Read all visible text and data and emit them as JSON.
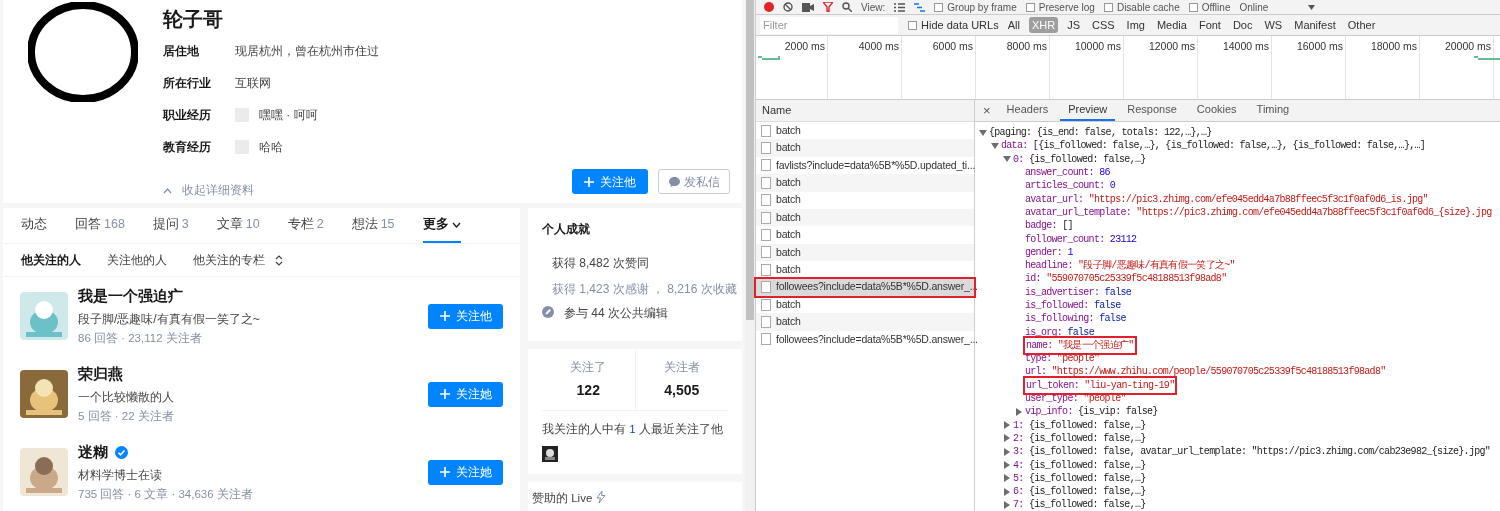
{
  "profile": {
    "name": "轮子哥",
    "info": [
      {
        "label": "居住地",
        "value": "现居杭州，曾在杭州市住过",
        "has_logo": false
      },
      {
        "label": "所在行业",
        "value": "互联网",
        "has_logo": false
      },
      {
        "label": "职业经历",
        "value": "嘿嘿 · 呵呵",
        "has_logo": true
      },
      {
        "label": "教育经历",
        "value": "哈哈",
        "has_logo": true
      }
    ],
    "collapse_link": "收起详细资料",
    "follow_button": "关注他",
    "message_button": "发私信"
  },
  "tabs": [
    {
      "label": "动态",
      "selected": false
    },
    {
      "label": "回答",
      "count": "168",
      "selected": false
    },
    {
      "label": "提问",
      "count": "3",
      "selected": false
    },
    {
      "label": "文章",
      "count": "10",
      "selected": false
    },
    {
      "label": "专栏",
      "count": "2",
      "selected": false
    },
    {
      "label": "想法",
      "count": "15",
      "selected": false
    },
    {
      "label": "更多",
      "has_menu": true,
      "selected": true
    }
  ],
  "subtabs": [
    {
      "label": "他关注的人",
      "selected": true
    },
    {
      "label": "关注他的人",
      "selected": false
    },
    {
      "label": "他关注的专栏",
      "has_menu": true,
      "selected": false
    }
  ],
  "people": [
    {
      "name": "我是一个强迫疒",
      "verified": false,
      "headline": "段子脚/恶趣味/有真有假一笑了之~",
      "stats": "86 回答 · 23,112 关注者",
      "button": "关注他"
    },
    {
      "name": "荣归燕",
      "verified": false,
      "headline": "一个比较懒散的人",
      "stats": "5 回答 · 22 关注者",
      "button": "关注她"
    },
    {
      "name": "迷糊",
      "verified": true,
      "headline": "材料学博士在读",
      "stats": "735 回答 · 6 文章 · 34,636 关注者",
      "button": "关注她"
    }
  ],
  "achievements": {
    "title": "个人成就",
    "items": [
      {
        "kind": "like",
        "lines": [
          "获得 8,482 次赞同",
          "获得 1,423 次感谢 ， 8,216 次收藏"
        ]
      },
      {
        "kind": "edit",
        "lines": [
          "参与 44 次公共编辑"
        ]
      }
    ]
  },
  "follow_stats": [
    {
      "label": "关注了",
      "value": "122"
    },
    {
      "label": "关注者",
      "value": "4,505"
    }
  ],
  "mutual": {
    "before": "我关注的人中有 ",
    "link": "1",
    "after": " 人最近关注了他"
  },
  "live_title": "赞助的 Live",
  "devtools": {
    "toolbar": {
      "view_label": "View:",
      "checkboxes": [
        {
          "label": "Group by frame",
          "checked": false
        },
        {
          "label": "Preserve log",
          "checked": false
        },
        {
          "label": "Disable cache",
          "checked": false
        },
        {
          "label": "Offline",
          "checked": false
        }
      ],
      "throttle": "Online"
    },
    "filter_placeholder": "Filter",
    "hide_data_urls": {
      "label": "Hide data URLs",
      "checked": false
    },
    "types": [
      {
        "label": "All",
        "selected": false
      },
      {
        "label": "XHR",
        "selected": true
      },
      {
        "label": "JS",
        "selected": false
      },
      {
        "label": "CSS",
        "selected": false
      },
      {
        "label": "Img",
        "selected": false
      },
      {
        "label": "Media",
        "selected": false
      },
      {
        "label": "Font",
        "selected": false
      },
      {
        "label": "Doc",
        "selected": false
      },
      {
        "label": "WS",
        "selected": false
      },
      {
        "label": "Manifest",
        "selected": false
      },
      {
        "label": "Other",
        "selected": false
      }
    ],
    "timeline_ticks": [
      "2000 ms",
      "4000 ms",
      "6000 ms",
      "8000 ms",
      "10000 ms",
      "12000 ms",
      "14000 ms",
      "16000 ms",
      "18000 ms",
      "20000 ms"
    ],
    "name_header": "Name",
    "requests": [
      {
        "name": "batch",
        "selected": false,
        "annotated": false
      },
      {
        "name": "batch",
        "selected": false,
        "annotated": false
      },
      {
        "name": "favlists?include=data%5B*%5D.updated_ti...",
        "selected": false,
        "annotated": false
      },
      {
        "name": "batch",
        "selected": false,
        "annotated": false
      },
      {
        "name": "batch",
        "selected": false,
        "annotated": false
      },
      {
        "name": "batch",
        "selected": false,
        "annotated": false
      },
      {
        "name": "batch",
        "selected": false,
        "annotated": false
      },
      {
        "name": "batch",
        "selected": false,
        "annotated": false
      },
      {
        "name": "batch",
        "selected": false,
        "annotated": false
      },
      {
        "name": "followees?include=data%5B*%5D.answer_...",
        "selected": true,
        "annotated": true
      },
      {
        "name": "batch",
        "selected": false,
        "annotated": false
      },
      {
        "name": "batch",
        "selected": false,
        "annotated": false
      },
      {
        "name": "followees?include=data%5B*%5D.answer_...",
        "selected": false,
        "annotated": false
      }
    ],
    "close_symbol": "×",
    "detail_tabs": [
      {
        "label": "Headers",
        "selected": false
      },
      {
        "label": "Preview",
        "selected": true
      },
      {
        "label": "Response",
        "selected": false
      },
      {
        "label": "Cookies",
        "selected": false
      },
      {
        "label": "Timing",
        "selected": false
      }
    ],
    "preview": {
      "value": "{paging: {is_end: false, totals: 122,…},…}",
      "kind": "summary",
      "expanded": true,
      "children": [
        {
          "key": "data:",
          "value": "[{is_followed: false,…}, {is_followed: false,…}, {is_followed: false,…},…]",
          "kind": "summary",
          "expanded": true,
          "children": [
            {
              "key": "0:",
              "value": "{is_followed: false,…}",
              "kind": "summary",
              "expanded": true,
              "children": [
                {
                  "key": "answer_count:",
                  "value": "86",
                  "kind": "number"
                },
                {
                  "key": "articles_count:",
                  "value": "0",
                  "kind": "number"
                },
                {
                  "key": "avatar_url:",
                  "value": "\"https://pic3.zhimg.com/efe045edd4a7b88ffeec5f3c1f0af0d6_is.jpg\"",
                  "kind": "string"
                },
                {
                  "key": "avatar_url_template:",
                  "value": "\"https://pic3.zhimg.com/efe045edd4a7b88ffeec5f3c1f0af0d6_{size}.jpg",
                  "kind": "string"
                },
                {
                  "key": "badge:",
                  "value": "[]",
                  "kind": "summary"
                },
                {
                  "key": "follower_count:",
                  "value": "23112",
                  "kind": "number"
                },
                {
                  "key": "gender:",
                  "value": "1",
                  "kind": "number"
                },
                {
                  "key": "headline:",
                  "value": "\"段子脚/恶趣味/有真有假一笑了之~\"",
                  "kind": "string"
                },
                {
                  "key": "id:",
                  "value": "\"559070705c25339f5c48188513f98ad8\"",
                  "kind": "string"
                },
                {
                  "key": "is_advertiser:",
                  "value": "false",
                  "kind": "boolean"
                },
                {
                  "key": "is_followed:",
                  "value": "false",
                  "kind": "boolean"
                },
                {
                  "key": "is_following:",
                  "value": "false",
                  "kind": "boolean"
                },
                {
                  "key": "is_org:",
                  "value": "false",
                  "kind": "boolean"
                },
                {
                  "key": "name:",
                  "value": "\"我是一个强迫疒\"",
                  "kind": "string",
                  "annotated": true
                },
                {
                  "key": "type:",
                  "value": "\"people\"",
                  "kind": "string"
                },
                {
                  "key": "url:",
                  "value": "\"https://www.zhihu.com/people/559070705c25339f5c48188513f98ad8\"",
                  "kind": "string"
                },
                {
                  "key": "url_token:",
                  "value": "\"liu-yan-ting-19\"",
                  "kind": "string",
                  "annotated": true
                },
                {
                  "key": "user_type:",
                  "value": "\"people\"",
                  "kind": "string"
                },
                {
                  "key": "vip_info:",
                  "value": "{is_vip: false}",
                  "kind": "summary",
                  "expanded": false
                }
              ]
            },
            {
              "key": "1:",
              "value": "{is_followed: false,…}",
              "kind": "summary",
              "expanded": false
            },
            {
              "key": "2:",
              "value": "{is_followed: false,…}",
              "kind": "summary",
              "expanded": false
            },
            {
              "key": "3:",
              "value": "{is_followed: false, avatar_url_template: \"https://pic3.zhimg.com/cab23e982_{size}.jpg\"",
              "kind": "summary",
              "expanded": false
            },
            {
              "key": "4:",
              "value": "{is_followed: false,…}",
              "kind": "summary",
              "expanded": false
            },
            {
              "key": "5:",
              "value": "{is_followed: false,…}",
              "kind": "summary",
              "expanded": false
            },
            {
              "key": "6:",
              "value": "{is_followed: false,…}",
              "kind": "summary",
              "expanded": false
            },
            {
              "key": "7:",
              "value": "{is_followed: false,…}",
              "kind": "summary",
              "expanded": false
            }
          ]
        }
      ]
    }
  }
}
